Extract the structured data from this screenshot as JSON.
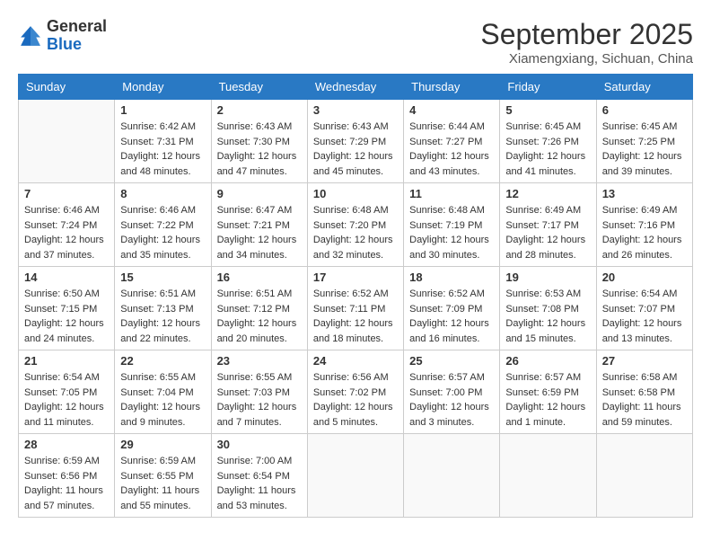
{
  "header": {
    "logo_line1": "General",
    "logo_line2": "Blue",
    "month_title": "September 2025",
    "location": "Xiamengxiang, Sichuan, China"
  },
  "weekdays": [
    "Sunday",
    "Monday",
    "Tuesday",
    "Wednesday",
    "Thursday",
    "Friday",
    "Saturday"
  ],
  "weeks": [
    [
      {
        "day": "",
        "info": ""
      },
      {
        "day": "1",
        "info": "Sunrise: 6:42 AM\nSunset: 7:31 PM\nDaylight: 12 hours\nand 48 minutes."
      },
      {
        "day": "2",
        "info": "Sunrise: 6:43 AM\nSunset: 7:30 PM\nDaylight: 12 hours\nand 47 minutes."
      },
      {
        "day": "3",
        "info": "Sunrise: 6:43 AM\nSunset: 7:29 PM\nDaylight: 12 hours\nand 45 minutes."
      },
      {
        "day": "4",
        "info": "Sunrise: 6:44 AM\nSunset: 7:27 PM\nDaylight: 12 hours\nand 43 minutes."
      },
      {
        "day": "5",
        "info": "Sunrise: 6:45 AM\nSunset: 7:26 PM\nDaylight: 12 hours\nand 41 minutes."
      },
      {
        "day": "6",
        "info": "Sunrise: 6:45 AM\nSunset: 7:25 PM\nDaylight: 12 hours\nand 39 minutes."
      }
    ],
    [
      {
        "day": "7",
        "info": "Sunrise: 6:46 AM\nSunset: 7:24 PM\nDaylight: 12 hours\nand 37 minutes."
      },
      {
        "day": "8",
        "info": "Sunrise: 6:46 AM\nSunset: 7:22 PM\nDaylight: 12 hours\nand 35 minutes."
      },
      {
        "day": "9",
        "info": "Sunrise: 6:47 AM\nSunset: 7:21 PM\nDaylight: 12 hours\nand 34 minutes."
      },
      {
        "day": "10",
        "info": "Sunrise: 6:48 AM\nSunset: 7:20 PM\nDaylight: 12 hours\nand 32 minutes."
      },
      {
        "day": "11",
        "info": "Sunrise: 6:48 AM\nSunset: 7:19 PM\nDaylight: 12 hours\nand 30 minutes."
      },
      {
        "day": "12",
        "info": "Sunrise: 6:49 AM\nSunset: 7:17 PM\nDaylight: 12 hours\nand 28 minutes."
      },
      {
        "day": "13",
        "info": "Sunrise: 6:49 AM\nSunset: 7:16 PM\nDaylight: 12 hours\nand 26 minutes."
      }
    ],
    [
      {
        "day": "14",
        "info": "Sunrise: 6:50 AM\nSunset: 7:15 PM\nDaylight: 12 hours\nand 24 minutes."
      },
      {
        "day": "15",
        "info": "Sunrise: 6:51 AM\nSunset: 7:13 PM\nDaylight: 12 hours\nand 22 minutes."
      },
      {
        "day": "16",
        "info": "Sunrise: 6:51 AM\nSunset: 7:12 PM\nDaylight: 12 hours\nand 20 minutes."
      },
      {
        "day": "17",
        "info": "Sunrise: 6:52 AM\nSunset: 7:11 PM\nDaylight: 12 hours\nand 18 minutes."
      },
      {
        "day": "18",
        "info": "Sunrise: 6:52 AM\nSunset: 7:09 PM\nDaylight: 12 hours\nand 16 minutes."
      },
      {
        "day": "19",
        "info": "Sunrise: 6:53 AM\nSunset: 7:08 PM\nDaylight: 12 hours\nand 15 minutes."
      },
      {
        "day": "20",
        "info": "Sunrise: 6:54 AM\nSunset: 7:07 PM\nDaylight: 12 hours\nand 13 minutes."
      }
    ],
    [
      {
        "day": "21",
        "info": "Sunrise: 6:54 AM\nSunset: 7:05 PM\nDaylight: 12 hours\nand 11 minutes."
      },
      {
        "day": "22",
        "info": "Sunrise: 6:55 AM\nSunset: 7:04 PM\nDaylight: 12 hours\nand 9 minutes."
      },
      {
        "day": "23",
        "info": "Sunrise: 6:55 AM\nSunset: 7:03 PM\nDaylight: 12 hours\nand 7 minutes."
      },
      {
        "day": "24",
        "info": "Sunrise: 6:56 AM\nSunset: 7:02 PM\nDaylight: 12 hours\nand 5 minutes."
      },
      {
        "day": "25",
        "info": "Sunrise: 6:57 AM\nSunset: 7:00 PM\nDaylight: 12 hours\nand 3 minutes."
      },
      {
        "day": "26",
        "info": "Sunrise: 6:57 AM\nSunset: 6:59 PM\nDaylight: 12 hours\nand 1 minute."
      },
      {
        "day": "27",
        "info": "Sunrise: 6:58 AM\nSunset: 6:58 PM\nDaylight: 11 hours\nand 59 minutes."
      }
    ],
    [
      {
        "day": "28",
        "info": "Sunrise: 6:59 AM\nSunset: 6:56 PM\nDaylight: 11 hours\nand 57 minutes."
      },
      {
        "day": "29",
        "info": "Sunrise: 6:59 AM\nSunset: 6:55 PM\nDaylight: 11 hours\nand 55 minutes."
      },
      {
        "day": "30",
        "info": "Sunrise: 7:00 AM\nSunset: 6:54 PM\nDaylight: 11 hours\nand 53 minutes."
      },
      {
        "day": "",
        "info": ""
      },
      {
        "day": "",
        "info": ""
      },
      {
        "day": "",
        "info": ""
      },
      {
        "day": "",
        "info": ""
      }
    ]
  ]
}
